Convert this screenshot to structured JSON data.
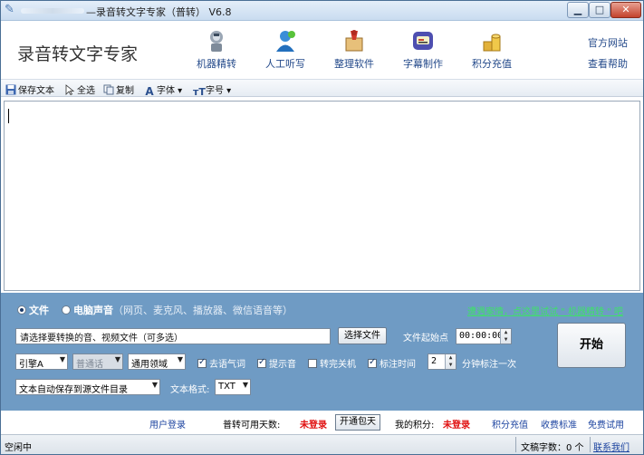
{
  "window": {
    "title": "—录音转文字专家（普转） V6.8"
  },
  "header": {
    "app_name": "录音转文字专家",
    "nav": [
      {
        "label": "机器精转",
        "icon": "robot-icon"
      },
      {
        "label": "人工听写",
        "icon": "person-icon"
      },
      {
        "label": "整理软件",
        "icon": "clipboard-icon"
      },
      {
        "label": "字幕制作",
        "icon": "subtitle-icon"
      },
      {
        "label": "积分充值",
        "icon": "coins-icon"
      }
    ],
    "official_site": "官方网站",
    "help": "查看帮助"
  },
  "toolbar": {
    "save_text": "保存文本",
    "select_all": "全选",
    "copy": "复制",
    "font": "字体",
    "font_size": "字号"
  },
  "panel": {
    "source_file": "文件",
    "source_pc": "电脑声音",
    "source_pc_hint": "（网页、麦克风、播放器、微信语音等）",
    "selected_source": "文件",
    "tip_link": "遭遇案情，点这里试试 \" 机器精转 \" 吧",
    "file_input": "请选择要转换的音、视频文件（可多选）",
    "choose_file": "选择文件",
    "start_point_label": "文件起始点",
    "start_point": "00:00:00",
    "start": "开始",
    "engine": "引擎A",
    "dialect": "普通话",
    "domain": "通用领域",
    "options": [
      {
        "label": "去语气词",
        "checked": true
      },
      {
        "label": "提示音",
        "checked": true
      },
      {
        "label": "转完关机",
        "checked": false
      },
      {
        "label": "标注时间",
        "checked": true
      }
    ],
    "interval": "2",
    "interval_label": "分钟标注一次",
    "save_mode": "文本自动保存到源文件目录",
    "format_label": "文本格式:",
    "format": "TXT"
  },
  "info": {
    "user_login": "用户登录",
    "days_label": "普转可用天数:",
    "days_value": "未登录",
    "open_package": "开通包天",
    "points_label": "我的积分:",
    "points_value": "未登录",
    "recharge": "积分充值",
    "pricing": "收费标准",
    "free_trial": "免费试用"
  },
  "statusbar": {
    "status": "空闲中",
    "word_count": "文稿字数：0 个",
    "contact": "联系我们"
  },
  "colors": {
    "panel_bg": "#6f9bc4",
    "red_value": "#e01010",
    "link_blue": "#1d44a0",
    "tip_green": "#3fe06a"
  }
}
